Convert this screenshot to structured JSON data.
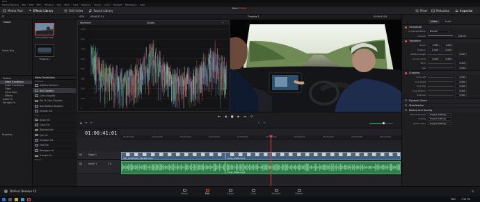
{
  "app": {
    "title": "Kona",
    "menu": [
      "DaVinci Resolve",
      "File",
      "Edit",
      "Trim",
      "Timeline",
      "Clip",
      "Mark",
      "View",
      "Playback",
      "Fusion",
      "Color",
      "Fairlight",
      "Workspace",
      "Help"
    ]
  },
  "toolbar": {
    "media_pool": "Media Pool",
    "effects_library": "Effects Library",
    "edit_index": "Edit Index",
    "sound_library": "Sound Library",
    "zoom": "47%",
    "timecode_left": "00:00:27:11",
    "project_name": "Kona",
    "project_status": "Edited",
    "mixer": "Mixer",
    "metadata": "Metadata",
    "inspector": "Inspector"
  },
  "subbar": {
    "timeline_name": "Timeline 1",
    "timecode_right": "01:00:41:01",
    "clip_name": "Kona_Stella.mp4"
  },
  "bins": {
    "master": "Master",
    "smart_bins": "Smart Bins"
  },
  "media": {
    "clips": [
      {
        "name": "Kona_Stella.mp4"
      },
      {
        "name": "Timeline 1"
      }
    ]
  },
  "fx_toolbox": {
    "items": [
      {
        "label": "Toolbox",
        "selected": false
      },
      {
        "label": "Video Transitions",
        "selected": true
      },
      {
        "label": "Audio Transitions",
        "selected": false
      },
      {
        "label": "Titles",
        "selected": false
      },
      {
        "label": "Generators",
        "selected": false
      },
      {
        "label": "Effects",
        "selected": false
      },
      {
        "label": "Audio FX",
        "selected": false
      },
      {
        "label": "Fairlight FX",
        "selected": false
      }
    ],
    "favorites": "Favorites"
  },
  "fx_list": {
    "header": "Video Transitions",
    "group1": "Dissolve",
    "group1_items": [
      {
        "label": "Additive Dissolve",
        "selected": false
      },
      {
        "label": "Blur Dissolve",
        "selected": true
      },
      {
        "label": "Cross Dissolve",
        "selected": false
      },
      {
        "label": "Dip To Color Dissolve",
        "selected": false
      },
      {
        "label": "Non-Additive Dissolve",
        "selected": false
      },
      {
        "label": "Smooth Cut",
        "selected": false
      }
    ],
    "group2": "Iris",
    "group2_items": [
      {
        "label": "Arrow Iris"
      },
      {
        "label": "Cross Iris"
      },
      {
        "label": "Diamond Iris"
      },
      {
        "label": "Eye Iris"
      },
      {
        "label": "Hexagon Iris"
      },
      {
        "label": "Oval Iris"
      },
      {
        "label": "Pentagon Iris"
      },
      {
        "label": "Triangle Iris"
      }
    ],
    "group3": "Motion"
  },
  "scopes": {
    "title": "Scopes",
    "mode": "Waveform",
    "scale": [
      "1023",
      "896",
      "768",
      "640",
      "512",
      "384",
      "256",
      "128",
      "0"
    ]
  },
  "transport": {
    "timecode": "01:00:41:01"
  },
  "timeline": {
    "ruler": [
      "01:00:15:00",
      "01:00:20:00",
      "01:00:25:00",
      "01:00:30:00",
      "01:00:35:00",
      "01:00:40:00",
      "01:00:45:00",
      "01:00:50:00",
      "01:00:55:00",
      "01:01:00:00"
    ],
    "v1_label": "Video 1",
    "v1_tag": "V1",
    "a1_label": "Audio 1",
    "a1_tag": "A1",
    "a1_level": "2.0",
    "clip_a": "VID_20180906_192426.mp4",
    "clip_b": "Kona_Stella.mp4",
    "clip_c": "Kona_Stella.mp4"
  },
  "inspector": {
    "tabs": [
      {
        "label": "Video",
        "active": true
      },
      {
        "label": "Audio",
        "active": false
      }
    ],
    "composite": {
      "title": "Composite",
      "mode_label": "Composite Mode",
      "mode_value": "Normal",
      "opacity_label": "Opacity",
      "opacity_value": "100.00"
    },
    "transform": {
      "title": "Transform",
      "rows": [
        {
          "label": "Zoom",
          "x": "1.000",
          "y": "1.000"
        },
        {
          "label": "Position",
          "x": "0.000",
          "y": "0.000"
        },
        {
          "label": "Rotation Angle",
          "x": "0.000"
        },
        {
          "label": "Anchor Point",
          "x": "0.000",
          "y": "0.000"
        },
        {
          "label": "Pitch",
          "x": "0.000"
        },
        {
          "label": "Yaw",
          "x": "0.000"
        }
      ]
    },
    "cropping": {
      "title": "Cropping",
      "rows": [
        {
          "label": "Crop Left",
          "x": "0.000"
        },
        {
          "label": "Crop Right",
          "x": "0.000"
        },
        {
          "label": "Crop Top",
          "x": "0.000"
        },
        {
          "label": "Crop Bottom",
          "x": "0.000"
        },
        {
          "label": "Softness",
          "x": "0.000"
        }
      ]
    },
    "dynamic_zoom": {
      "title": "Dynamic Zoom"
    },
    "stabilization": {
      "title": "Stabilization"
    },
    "retime": {
      "title": "Retime And Scaling",
      "rows": [
        {
          "label": "Retime Process",
          "value": "Project Settings"
        },
        {
          "label": "Scaling",
          "value": "Project Settings"
        },
        {
          "label": "Resize Filter",
          "value": "Project Settings"
        }
      ]
    }
  },
  "pagebar": {
    "brand": "DaVinci Resolve 15",
    "pages": [
      {
        "label": "Media",
        "active": false
      },
      {
        "label": "Edit",
        "active": true
      },
      {
        "label": "Fusion",
        "active": false
      },
      {
        "label": "Color",
        "active": false
      },
      {
        "label": "Fairlight",
        "active": false
      },
      {
        "label": "Deliver",
        "active": false
      }
    ]
  },
  "taskbar": {
    "lang": "ENG",
    "time": "7:56 PM"
  }
}
